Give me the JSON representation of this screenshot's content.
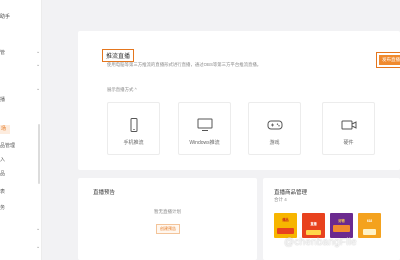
{
  "sidebar": {
    "brand": "助手",
    "items": [
      {
        "label": "管",
        "chevron": "⌄"
      },
      {
        "label": "",
        "chevron": "⌄"
      },
      {
        "label": "",
        "chevron": ""
      },
      {
        "label": "",
        "chevron": "⌄"
      },
      {
        "label": "播",
        "chevron": ""
      },
      {
        "label": "",
        "chevron": ""
      },
      {
        "label": "场",
        "chevron": ""
      },
      {
        "label": "品管理",
        "chevron": ""
      },
      {
        "label": "入",
        "chevron": ""
      },
      {
        "label": "品",
        "chevron": ""
      },
      {
        "label": "表",
        "chevron": ""
      },
      {
        "label": "务",
        "chevron": ""
      },
      {
        "label": "",
        "chevron": "⌄"
      },
      {
        "label": "",
        "chevron": "⌄"
      }
    ]
  },
  "main": {
    "title": "推流直播",
    "description": "使用电脑等第三方推流的直播形式进行直播，通过OBS等第三方平台推流直播。",
    "publish_button": "发布直播",
    "toggle_label": "展示直播方式",
    "tools": [
      {
        "label": "手机推流",
        "icon": "phone-icon"
      },
      {
        "label": "Windows推流",
        "icon": "monitor-icon"
      },
      {
        "label": "游戏",
        "icon": "gamepad-icon"
      },
      {
        "label": "硬件",
        "icon": "camera-icon"
      }
    ]
  },
  "notice": {
    "title": "直播预告",
    "empty_text": "暂无直播计划",
    "create_button": "创建预告"
  },
  "goods": {
    "title": "直播商品管理",
    "count": "合计 4",
    "thumbs": [
      {
        "label": "爆品",
        "color": "#f7b500"
      },
      {
        "label": "直播",
        "color": "#e8421e"
      },
      {
        "label": "好物",
        "color": "#6b2a8f"
      },
      {
        "label": "618",
        "color": "#f4a21e"
      }
    ]
  },
  "watermark": "@chenbangFlle",
  "colors": {
    "accent": "#e4761e",
    "button": "#f08a2e"
  }
}
